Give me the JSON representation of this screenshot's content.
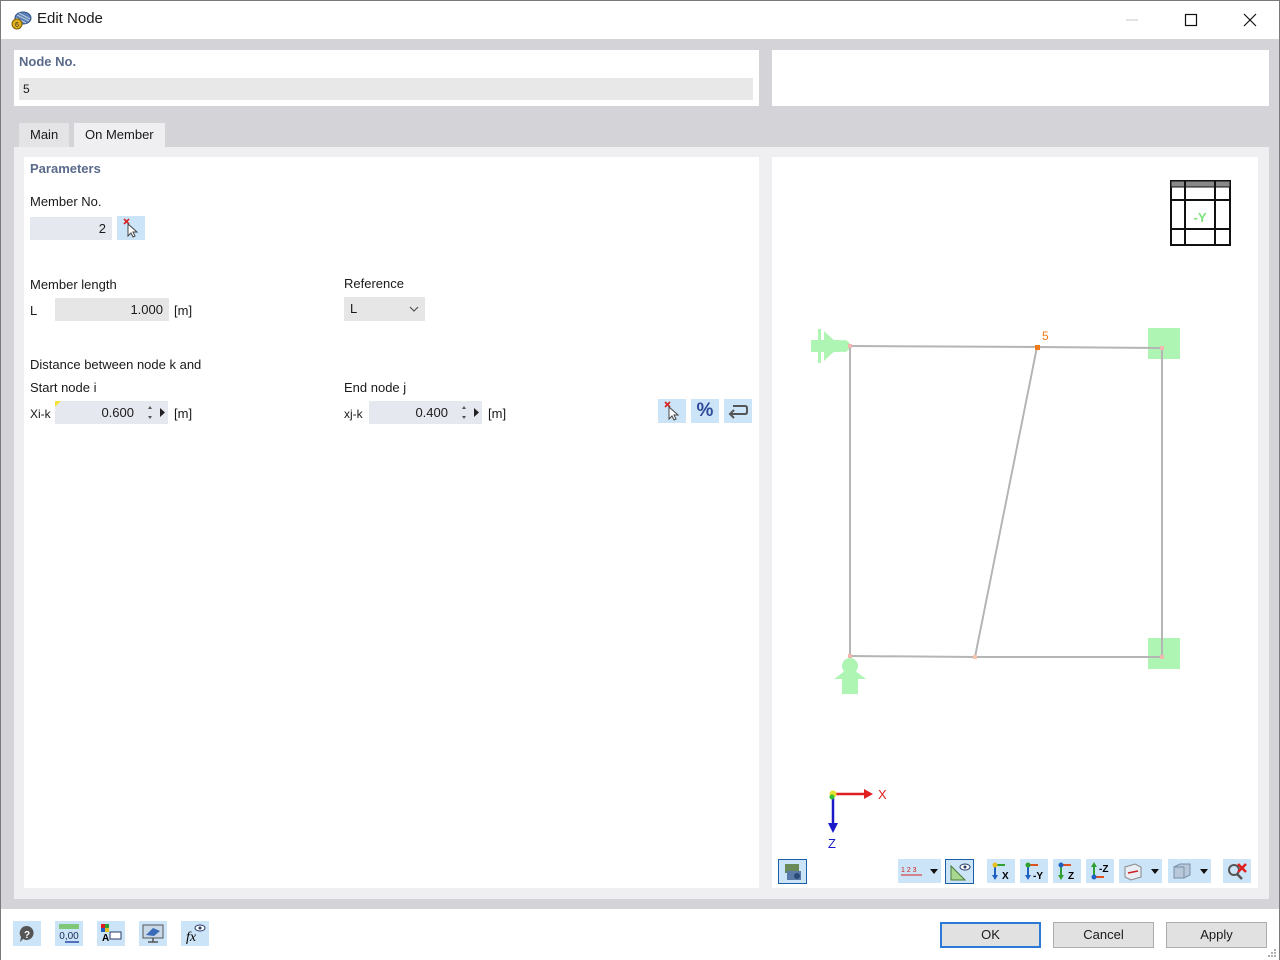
{
  "window": {
    "title": "Edit Node",
    "icon": "rfem-node-icon",
    "controls": [
      "minimize-icon",
      "maximize-icon",
      "close-icon"
    ]
  },
  "node": {
    "label": "Node No.",
    "value": "5"
  },
  "tabs": [
    {
      "label": "Main",
      "active": false
    },
    {
      "label": "On Member",
      "active": true
    }
  ],
  "parameters": {
    "title": "Parameters",
    "member_no": {
      "label": "Member No.",
      "value": "2",
      "pick_icon": "pick-member-cursor-icon"
    },
    "member_length": {
      "label": "Member length",
      "symbol": "L",
      "value": "1.000",
      "unit": "[m]"
    },
    "reference": {
      "label": "Reference",
      "value": "L"
    },
    "distance_title": "Distance between node k and",
    "start_node": {
      "label": "Start node i",
      "symbol": "Xi-k",
      "value": "0.600",
      "unit": "[m]"
    },
    "end_node": {
      "label": "End node j",
      "symbol": "xj-k",
      "value": "0.400",
      "unit": "[m]"
    },
    "action_icons": [
      "pick-point-cursor-icon",
      "percent-icon",
      "reverse-direction-icon"
    ],
    "percent_label": "%"
  },
  "view": {
    "cube_label": "-Y",
    "node_label": "5",
    "axis_x": "X",
    "axis_z": "Z",
    "colors": {
      "member": "#b5b5b5",
      "node_highlight": "#f07a1a",
      "support": "#aef5b3",
      "axis_x": "#e02020",
      "axis_z": "#1a1ac8"
    },
    "toolbar": {
      "left_icon": "view-render-icon",
      "numbering_label": "1 2 3",
      "buttons": [
        "numbering-dropdown",
        "view-visibility-icon",
        "view-x-icon",
        "view-minus-y-icon",
        "view-z-icon",
        "view-minus-z-icon",
        "section-view-dropdown",
        "display-model-dropdown",
        "zoom-reset-icon"
      ],
      "view_labels": {
        "x": "X",
        "my": "-Y",
        "z": "Z",
        "mz": "-Z"
      }
    }
  },
  "footer": {
    "icons": [
      "help-icon",
      "units-icon",
      "text-style-icon",
      "display-view-icon",
      "formula-icon"
    ],
    "units_text": "0,00",
    "formula_text": "fx",
    "buttons": {
      "ok": "OK",
      "cancel": "Cancel",
      "apply": "Apply"
    }
  }
}
